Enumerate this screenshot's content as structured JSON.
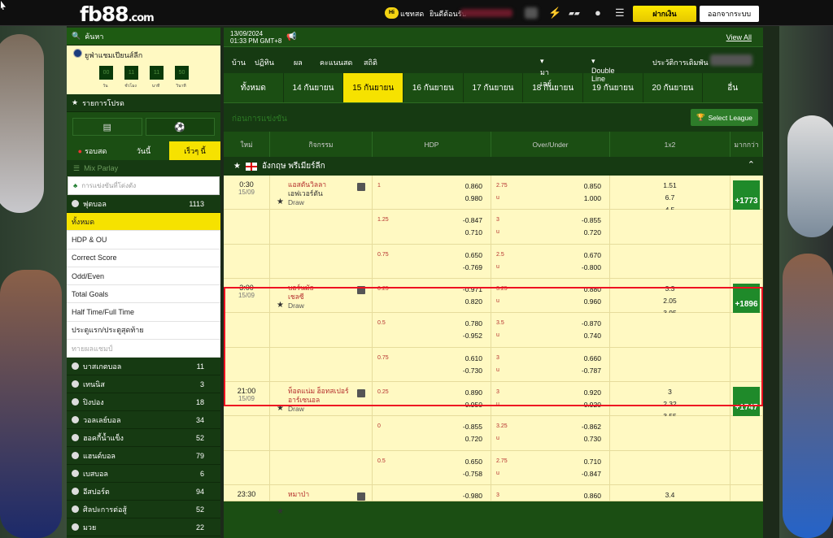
{
  "topbar": {
    "logo": "fb88",
    "logo_suffix": ".com",
    "chat_icon_label": "Hi",
    "chat": "แชทสด",
    "welcome": "ยินดีต้อนรับ",
    "deposit": "ฝากเงิน",
    "logout": "ออกจากระบบ"
  },
  "sidebar": {
    "search_label": "ค้นหา",
    "league": "ยูฟ่าแชมเปียนส์ลีก",
    "countdown": [
      "00",
      "11",
      "11",
      "50"
    ],
    "countdown_labels": [
      "วัน",
      "ชั่วโมง",
      "นาที",
      "วินาที"
    ],
    "my_bets": "รายการโปรด",
    "day_tabs": [
      "รอบสด",
      "วันนี้",
      "เร็วๆ นี้"
    ],
    "mix_parlay": "Mix Parlay",
    "search_placeholder": "การแข่งขันที่โด่งดัง",
    "football": {
      "name": "ฟุตบอล",
      "count": "1113"
    },
    "sub_items": [
      "ทั้งหมด",
      "HDP & OU",
      "Correct Score",
      "Odd/Even",
      "Total Goals",
      "Half Time/Full Time",
      "ประตูแรก/ประตูสุดท้าย",
      "ทายผลแชมป์"
    ],
    "sports": [
      {
        "name": "บาสเกตบอล",
        "count": "11"
      },
      {
        "name": "เทนนิส",
        "count": "3"
      },
      {
        "name": "ปิงปอง",
        "count": "18"
      },
      {
        "name": "วอลเลย์บอล",
        "count": "34"
      },
      {
        "name": "ฮอคกี้น้ำแข็ง",
        "count": "52"
      },
      {
        "name": "แฮนด์บอล",
        "count": "79"
      },
      {
        "name": "เบสบอล",
        "count": "6"
      },
      {
        "name": "อีสปอร์ต",
        "count": "94"
      },
      {
        "name": "ศิลปะการต่อสู้",
        "count": "52"
      },
      {
        "name": "มวย",
        "count": "22"
      }
    ]
  },
  "main": {
    "date": "13/09/2024",
    "time": "01:33 PM GMT+8",
    "view_all": "View All",
    "menu": [
      "บ้าน",
      "ปฏิทิน",
      "ผล",
      "คะแนนสด",
      "สถิติ"
    ],
    "lang": "มาเลย์",
    "odds_type": "Double Line",
    "history": "ประวัติการเดิมพัน",
    "date_tabs": [
      "ทั้งหมด",
      "14 กันยายน",
      "15 กันยายน",
      "16 กันยายน",
      "17 กันยายน",
      "18 กันยายน",
      "19 กันยายน",
      "20 กันยายน",
      "อื่น"
    ],
    "pregame": "ก่อนการแข่งขัน",
    "select_league": "Select League",
    "columns": [
      "ใหม่",
      "กิจกรรม",
      "HDP",
      "Over/Under",
      "1x2",
      "มากกว่า"
    ],
    "league_name": "อังกฤษ พรีเมียร์ลีก"
  },
  "matches": [
    {
      "time": "0:30",
      "date": "15/09",
      "home": "แอสตันวิลลา",
      "away": "เอฟเวอร์ตัน",
      "away_red": false,
      "draw": "Draw",
      "x12": [
        "1.51",
        "6.7",
        "4.5"
      ],
      "more": "+1773",
      "lines": [
        {
          "hk": "1",
          "h1": "0.860",
          "h2": "0.980",
          "ok": "2.75",
          "o1": "0.850",
          "o2": "1.000"
        },
        {
          "hk": "1.25",
          "h1": "-0.847",
          "h2": "0.710",
          "ok": "3",
          "o1": "-0.855",
          "o2": "0.720"
        },
        {
          "hk": "0.75",
          "h1": "0.650",
          "h2": "-0.769",
          "ok": "2.5",
          "o1": "0.670",
          "o2": "-0.800"
        }
      ]
    },
    {
      "time": "3:00",
      "date": "15/09",
      "home": "บอร์นมัธ",
      "away": "เชลซี",
      "away_red": true,
      "draw": "Draw",
      "x12": [
        "3.3",
        "2.05",
        "3.95"
      ],
      "more": "+1896",
      "lines": [
        {
          "hk": "0.25",
          "h1": "-0.971",
          "h2": "0.820",
          "ok": "3.25",
          "o1": "0.880",
          "o2": "0.960"
        },
        {
          "hk": "0.5",
          "h1": "0.780",
          "h2": "-0.952",
          "ok": "3.5",
          "o1": "-0.870",
          "o2": "0.740"
        },
        {
          "hk": "0.75",
          "h1": "0.610",
          "h2": "-0.730",
          "ok": "3",
          "o1": "0.660",
          "o2": "-0.787"
        }
      ]
    },
    {
      "time": "21:00",
      "date": "15/09",
      "home": "ท็อตแน่ม ฮ็อทสเปอร์",
      "away": "อาร์เซนอล",
      "away_red": true,
      "draw": "Draw",
      "x12": [
        "3",
        "2.32",
        "3.55"
      ],
      "more": "+1747",
      "lines": [
        {
          "hk": "0.25",
          "h1": "0.890",
          "h2": "0.950",
          "ok": "3",
          "o1": "0.920",
          "o2": "0.920"
        },
        {
          "hk": "0",
          "h1": "-0.855",
          "h2": "0.720",
          "ok": "3.25",
          "o1": "-0.862",
          "o2": "0.730"
        },
        {
          "hk": "0.5",
          "h1": "0.650",
          "h2": "-0.758",
          "ok": "2.75",
          "o1": "0.710",
          "o2": "-0.847"
        }
      ]
    },
    {
      "time": "23:30",
      "date": "",
      "home": "หมาป่า",
      "away": "",
      "away_red": false,
      "draw": "",
      "x12": [
        "3.4",
        "",
        ""
      ],
      "more": "",
      "lines": [
        {
          "hk": "",
          "h1": "-0.980",
          "h2": "",
          "ok": "3",
          "o1": "0.860",
          "o2": ""
        }
      ]
    }
  ]
}
